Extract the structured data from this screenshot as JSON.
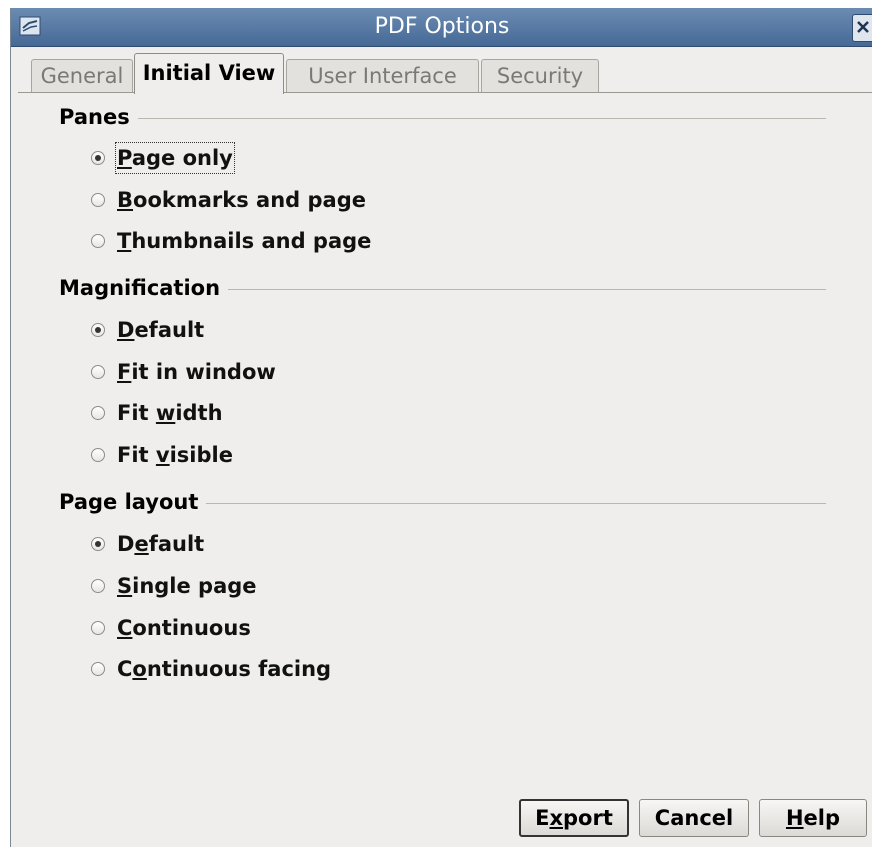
{
  "window": {
    "title": "PDF Options"
  },
  "tabs": [
    {
      "label": "General",
      "active": false
    },
    {
      "label": "Initial View",
      "active": true
    },
    {
      "label": "User Interface",
      "active": false
    },
    {
      "label": "Security",
      "active": false
    }
  ],
  "panes": {
    "title": "Panes",
    "options": [
      {
        "pre": "",
        "u": "P",
        "post": "age only",
        "selected": true
      },
      {
        "pre": "",
        "u": "B",
        "post": "ookmarks and page",
        "selected": false
      },
      {
        "pre": "",
        "u": "T",
        "post": "humbnails and page",
        "selected": false
      }
    ]
  },
  "magnification": {
    "title": "Magnification",
    "options": [
      {
        "pre": "",
        "u": "D",
        "post": "efault",
        "selected": true
      },
      {
        "pre": "",
        "u": "F",
        "post": "it in window",
        "selected": false
      },
      {
        "pre": "Fit ",
        "u": "w",
        "post": "idth",
        "selected": false
      },
      {
        "pre": "Fit ",
        "u": "v",
        "post": "isible",
        "selected": false
      }
    ]
  },
  "page_layout": {
    "title": "Page layout",
    "options": [
      {
        "pre": "D",
        "u": "e",
        "post": "fault",
        "selected": true
      },
      {
        "pre": "",
        "u": "S",
        "post": "ingle page",
        "selected": false
      },
      {
        "pre": "",
        "u": "C",
        "post": "ontinuous",
        "selected": false
      },
      {
        "pre": "C",
        "u": "o",
        "post": "ntinuous facing",
        "selected": false
      }
    ]
  },
  "buttons": {
    "export": {
      "pre": "E",
      "u": "x",
      "post": "port"
    },
    "cancel": {
      "pre": "",
      "u": "",
      "post": "Cancel"
    },
    "help": {
      "pre": "",
      "u": "H",
      "post": "elp"
    }
  }
}
